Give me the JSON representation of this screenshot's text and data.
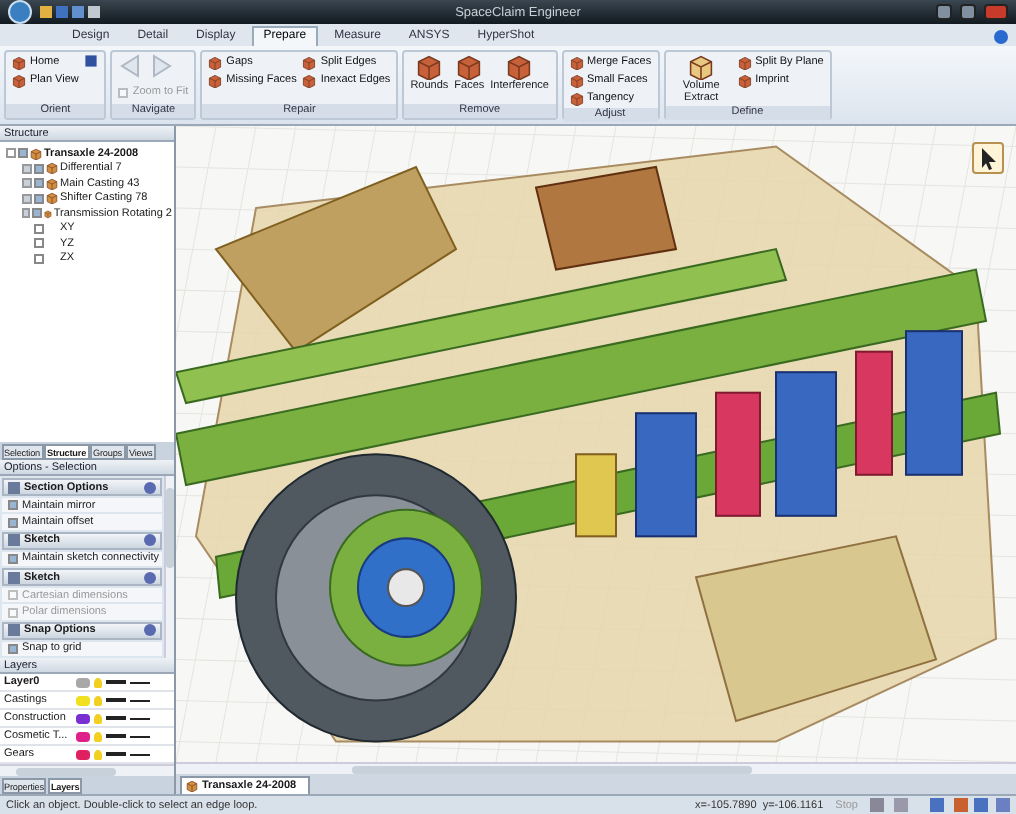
{
  "window": {
    "title": "SpaceClaim Engineer"
  },
  "tabs": [
    {
      "label": "Design",
      "selected": false
    },
    {
      "label": "Detail",
      "selected": false
    },
    {
      "label": "Display",
      "selected": false
    },
    {
      "label": "Prepare",
      "selected": true
    },
    {
      "label": "Measure",
      "selected": false
    },
    {
      "label": "ANSYS",
      "selected": false
    },
    {
      "label": "HyperShot",
      "selected": false
    }
  ],
  "ribbon": [
    {
      "label": "Orient",
      "items": [
        {
          "label": "Home",
          "kind": "small"
        },
        {
          "label": "Plan View",
          "kind": "small"
        }
      ]
    },
    {
      "label": "Navigate",
      "items": [
        {
          "label": "Zoom to Fit",
          "kind": "check",
          "disabled": true
        }
      ]
    },
    {
      "label": "Repair",
      "items": [
        {
          "label": "Gaps",
          "kind": "small"
        },
        {
          "label": "Split Edges",
          "kind": "small"
        },
        {
          "label": "Missing Faces",
          "kind": "small"
        },
        {
          "label": "Inexact Edges",
          "kind": "small"
        }
      ]
    },
    {
      "label": "Remove",
      "items": [
        {
          "label": "Rounds",
          "kind": "large"
        },
        {
          "label": "Faces",
          "kind": "large"
        },
        {
          "label": "Interference",
          "kind": "large"
        }
      ]
    },
    {
      "label": "Adjust",
      "items": [
        {
          "label": "Merge Faces",
          "kind": "small"
        },
        {
          "label": "Small Faces",
          "kind": "small"
        },
        {
          "label": "Tangency",
          "kind": "small"
        }
      ]
    },
    {
      "label": "Define",
      "items": [
        {
          "label": "Volume Extract",
          "kind": "large"
        },
        {
          "label": "Split By Plane",
          "kind": "small"
        },
        {
          "label": "Imprint",
          "kind": "small"
        }
      ]
    }
  ],
  "structure": {
    "title": "Structure",
    "tree": [
      {
        "label": "Transaxle 24-2008",
        "checked": true,
        "expanded": true,
        "children": [
          {
            "label": "Differential 7",
            "checked": true,
            "expanded": false
          },
          {
            "label": "Main Casting 43",
            "checked": true,
            "expanded": false
          },
          {
            "label": "Shifter Casting 78",
            "checked": true,
            "expanded": false
          },
          {
            "label": "Transmission Rotating 2",
            "checked": true,
            "expanded": false
          },
          {
            "label": "XY",
            "checked": false
          },
          {
            "label": "YZ",
            "checked": false
          },
          {
            "label": "ZX",
            "checked": false
          }
        ]
      }
    ]
  },
  "panel_tabs": [
    {
      "label": "Selection",
      "selected": false
    },
    {
      "label": "Structure",
      "selected": true
    },
    {
      "label": "Groups",
      "selected": false
    },
    {
      "label": "Views",
      "selected": false
    }
  ],
  "options": {
    "title": "Options - Selection",
    "sections": [
      {
        "title": "Section Options",
        "options": [
          {
            "label": "Maintain mirror",
            "checked": true,
            "disabled": false
          },
          {
            "label": "Maintain offset",
            "checked": true,
            "disabled": false
          }
        ]
      },
      {
        "title": "Sketch",
        "options": [
          {
            "label": "Maintain sketch connectivity",
            "checked": true,
            "disabled": false
          }
        ]
      },
      {
        "title": "Sketch",
        "options": [
          {
            "label": "Cartesian dimensions",
            "checked": false,
            "disabled": true
          },
          {
            "label": "Polar dimensions",
            "checked": false,
            "disabled": true
          }
        ]
      },
      {
        "title": "Snap Options",
        "options": [
          {
            "label": "Snap to grid",
            "checked": true,
            "disabled": false
          }
        ]
      }
    ]
  },
  "layers": {
    "title": "Layers",
    "rows": [
      {
        "name": "Layer0",
        "selected": true,
        "color": "#a8a8a8"
      },
      {
        "name": "Castings",
        "selected": false,
        "color": "#f0e020"
      },
      {
        "name": "Construction",
        "selected": false,
        "color": "#7a30d0"
      },
      {
        "name": "Cosmetic T...",
        "selected": false,
        "color": "#e0208a"
      },
      {
        "name": "Gears",
        "selected": false,
        "color": "#e02060"
      }
    ]
  },
  "bottom_tabs": [
    {
      "label": "Properties",
      "selected": false
    },
    {
      "label": "Layers",
      "selected": true
    }
  ],
  "document_tab": "Transaxle 24-2008",
  "status_bar": {
    "message": "Click an object. Double-click to select an edge loop.",
    "coordinates": "x=-105.7890  y=-106.1161",
    "stop": "Stop"
  }
}
